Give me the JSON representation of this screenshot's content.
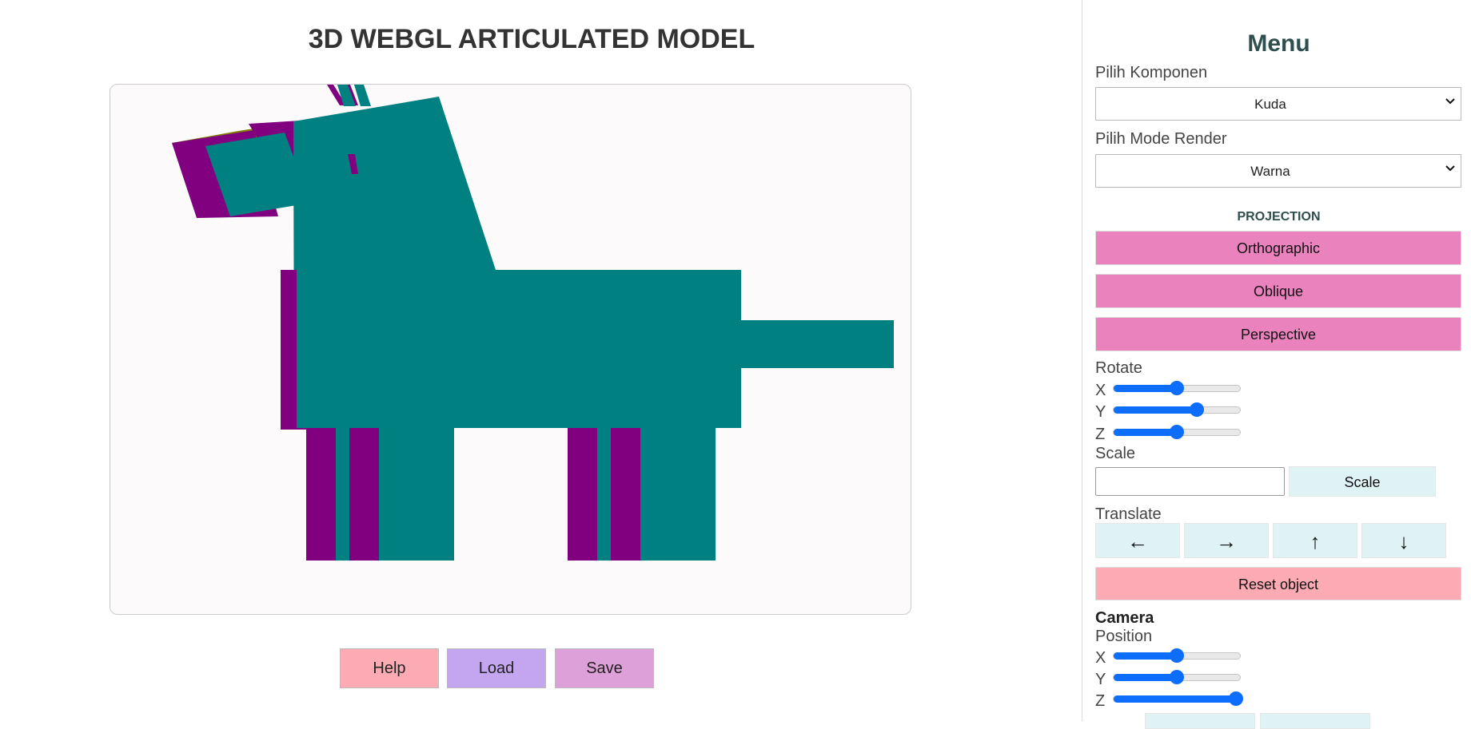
{
  "page": {
    "title": "3D WEBGL ARTICULATED MODEL"
  },
  "colors": {
    "model_primary": "#008080",
    "model_side": "#800080",
    "model_top": "#808000",
    "canvas_bg": "#fdfafb"
  },
  "bottom_buttons": {
    "help": {
      "label": "Help",
      "color": "#fcaab4"
    },
    "load": {
      "label": "Load",
      "color": "#c4a6f0"
    },
    "save": {
      "label": "Save",
      "color": "#dea0d8"
    }
  },
  "menu": {
    "title": "Menu",
    "component": {
      "label": "Pilih Komponen",
      "value": "Kuda"
    },
    "render_mode": {
      "label": "Pilih Mode Render",
      "value": "Warna"
    },
    "projection": {
      "heading": "PROJECTION",
      "buttons": [
        "Orthographic",
        "Oblique",
        "Perspective"
      ]
    },
    "rotate": {
      "label": "Rotate",
      "x": {
        "label": "X",
        "level": 0.5
      },
      "y": {
        "label": "Y",
        "level": 0.66
      },
      "z": {
        "label": "Z",
        "level": 0.5
      }
    },
    "scale": {
      "label": "Scale",
      "input_value": "",
      "button": "Scale"
    },
    "translate": {
      "label": "Translate",
      "left": "←",
      "right": "→",
      "up": "↑",
      "down": "↓"
    },
    "reset": "Reset object",
    "camera": {
      "heading": "Camera",
      "position_label": "Position",
      "x": {
        "label": "X",
        "level": 0.5
      },
      "y": {
        "label": "Y",
        "level": 0.5
      },
      "z": {
        "label": "Z",
        "level": 0.97
      }
    }
  }
}
